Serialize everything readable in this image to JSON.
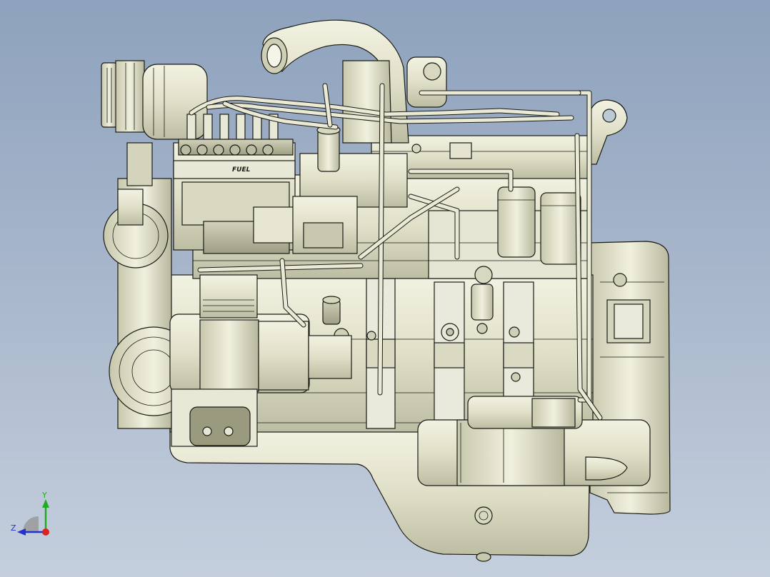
{
  "viewport": {
    "background_top": "#8ea2bd",
    "background_bottom": "#c4cfdd"
  },
  "model": {
    "part_color": "#e3e3cc",
    "edge_color": "#1a1a14",
    "pump_label": "FUEL"
  },
  "triad": {
    "y_label": "Y",
    "z_label": "Z",
    "y_color": "#22aa22",
    "z_color": "#2233cc",
    "x_color": "#dd2222"
  }
}
